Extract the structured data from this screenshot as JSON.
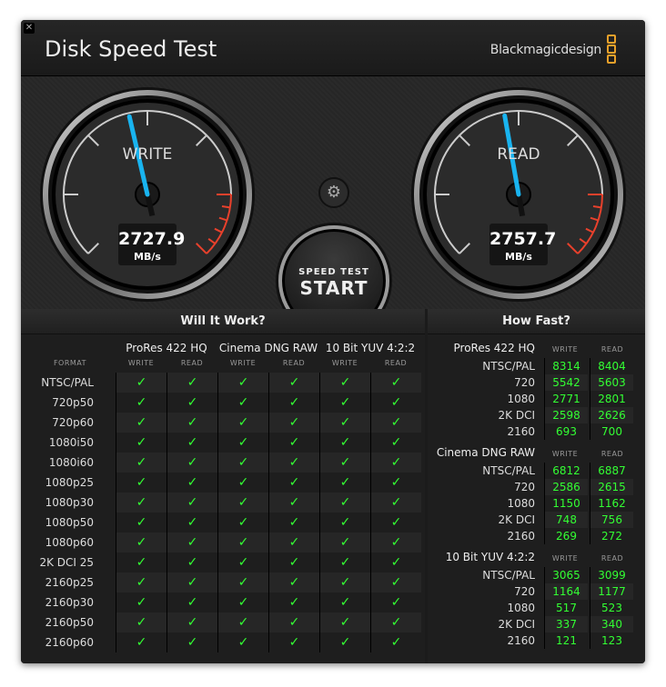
{
  "app": {
    "title": "Disk Speed Test",
    "brand": "Blackmagicdesign",
    "close_icon": "close-icon",
    "accent": "#19b4f0",
    "ok_color": "#33ff33"
  },
  "gauges": {
    "write": {
      "label": "WRITE",
      "value": "2727.9",
      "unit": "MB/s"
    },
    "read": {
      "label": "READ",
      "value": "2757.7",
      "unit": "MB/s"
    }
  },
  "settings_icon": "gear-icon",
  "start": {
    "line1": "SPEED TEST",
    "line2": "START"
  },
  "will_it_work": {
    "title": "Will It Work?",
    "format_header": "FORMAT",
    "groups": [
      "ProRes 422 HQ",
      "Cinema DNG RAW",
      "10 Bit YUV 4:2:2"
    ],
    "sub": [
      "WRITE",
      "READ"
    ],
    "check": "✓",
    "formats": [
      "NTSC/PAL",
      "720p50",
      "720p60",
      "1080i50",
      "1080i60",
      "1080p25",
      "1080p30",
      "1080p50",
      "1080p60",
      "2K DCI 25",
      "2160p25",
      "2160p30",
      "2160p50",
      "2160p60"
    ]
  },
  "how_fast": {
    "title": "How Fast?",
    "sub": [
      "WRITE",
      "READ"
    ],
    "groups": [
      {
        "name": "ProRes 422 HQ",
        "rows": [
          [
            "NTSC/PAL",
            "8314",
            "8404"
          ],
          [
            "720",
            "5542",
            "5603"
          ],
          [
            "1080",
            "2771",
            "2801"
          ],
          [
            "2K DCI",
            "2598",
            "2626"
          ],
          [
            "2160",
            "693",
            "700"
          ]
        ]
      },
      {
        "name": "Cinema DNG RAW",
        "rows": [
          [
            "NTSC/PAL",
            "6812",
            "6887"
          ],
          [
            "720",
            "2586",
            "2615"
          ],
          [
            "1080",
            "1150",
            "1162"
          ],
          [
            "2K DCI",
            "748",
            "756"
          ],
          [
            "2160",
            "269",
            "272"
          ]
        ]
      },
      {
        "name": "10 Bit YUV 4:2:2",
        "rows": [
          [
            "NTSC/PAL",
            "3065",
            "3099"
          ],
          [
            "720",
            "1164",
            "1177"
          ],
          [
            "1080",
            "517",
            "523"
          ],
          [
            "2K DCI",
            "337",
            "340"
          ],
          [
            "2160",
            "121",
            "123"
          ]
        ]
      }
    ]
  }
}
